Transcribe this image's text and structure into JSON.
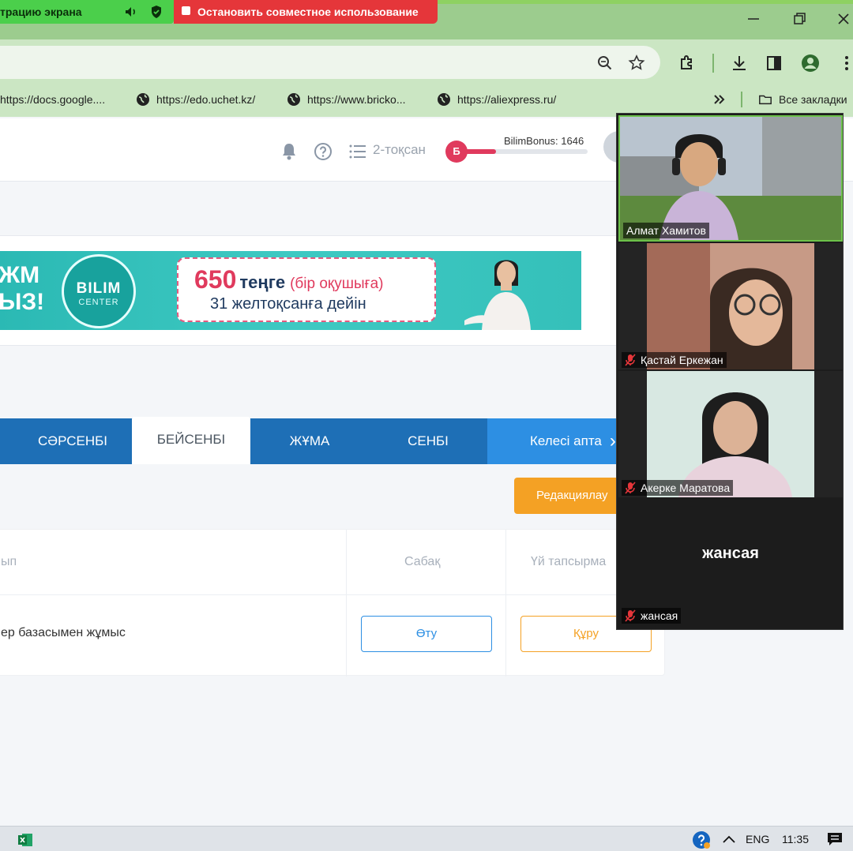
{
  "share_bar": {
    "status_text": "трацию экрана",
    "stop_label": "Остановить совместное использование"
  },
  "bookmarks": [
    {
      "label": "https://docs.google...."
    },
    {
      "label": "https://edo.uchet.kz/"
    },
    {
      "label": "https://www.bricko..."
    },
    {
      "label": "https://aliexpress.ru/"
    }
  ],
  "bookmarks_all": "Все закладки",
  "header": {
    "quarter": "2-тоқсан",
    "bonus_label": "BilimBonus:",
    "bonus_value": "1646",
    "bonus_badge": "Б",
    "bonus_progress": 0.32
  },
  "banner": {
    "left_text_line1": "ЖМ",
    "left_text_line2": "ЫЗ!",
    "logo_line1": "BILIM",
    "logo_line2": "CENTER",
    "price": "650",
    "currency": "теңге",
    "note": "(бір оқушыға)",
    "deadline": "31 желтоқсанға дейін"
  },
  "tabs": [
    {
      "label": "СӘРСЕНБІ",
      "active": false
    },
    {
      "label": "БЕЙСЕНБІ",
      "active": true
    },
    {
      "label": "ЖҰМА",
      "active": false
    },
    {
      "label": "СЕНБІ",
      "active": false
    }
  ],
  "next_week": "Келесі апта",
  "edit_button": "Редакциялау",
  "table": {
    "headers": [
      "ып",
      "Сабақ",
      "Үй тапсырма"
    ],
    "row": {
      "topic": "ер базасымен жұмыс",
      "lesson_button": "Өту",
      "homework_button": "Құру"
    }
  },
  "video": {
    "participants": [
      {
        "name": "Алмат Хамитов",
        "muted": false
      },
      {
        "name": "Қастай Еркежан",
        "muted": true
      },
      {
        "name": "Акерке Маратова",
        "muted": true
      },
      {
        "name": "жансая",
        "muted": true,
        "display_name": "жансая"
      }
    ]
  },
  "taskbar": {
    "lang": "ENG",
    "time": "11:35"
  },
  "colors": {
    "primary_blue": "#1e6fb6",
    "accent_orange": "#f4a124",
    "brand_red": "#e03a5d",
    "teal_banner": "#35c0ba"
  }
}
